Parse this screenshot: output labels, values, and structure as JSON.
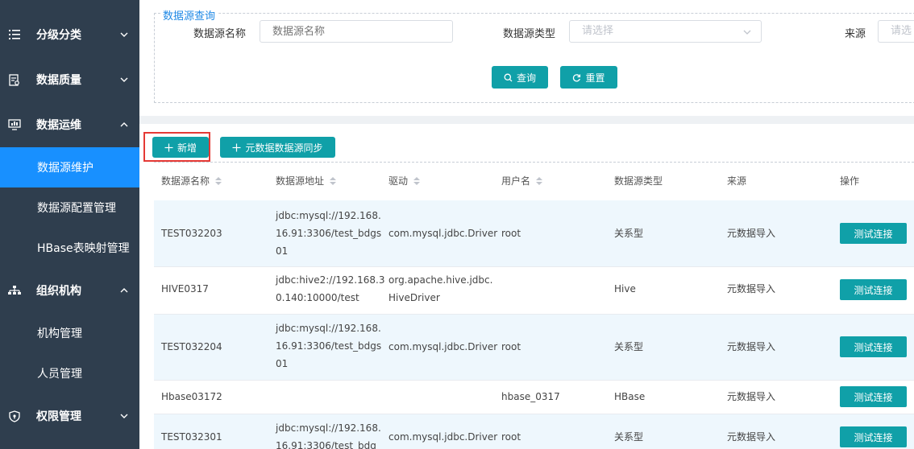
{
  "sidebar": {
    "items": [
      {
        "label": "分级分类",
        "icon": "list-icon",
        "expanded": false
      },
      {
        "label": "数据质量",
        "icon": "report-icon",
        "expanded": false
      },
      {
        "label": "数据运维",
        "icon": "monitor-icon",
        "expanded": true
      },
      {
        "label": "组织机构",
        "icon": "org-chart-icon",
        "expanded": true
      },
      {
        "label": "权限管理",
        "icon": "shield-icon",
        "expanded": false
      }
    ],
    "ops_children": [
      "数据源维护",
      "数据源配置管理",
      "HBase表映射管理"
    ],
    "org_children": [
      "机构管理",
      "人员管理"
    ],
    "active": "数据源维护",
    "colors": {
      "bg": "#2f3e4e",
      "active": "#1890ff"
    }
  },
  "query": {
    "legend": "数据源查询",
    "name_label": "数据源名称",
    "name_placeholder": "数据源名称",
    "type_label": "数据源类型",
    "type_placeholder": "请选择",
    "source_label": "来源",
    "source_placeholder": "请选",
    "search_label": "查询",
    "reset_label": "重置"
  },
  "toolbar": {
    "add_label": "新增",
    "sync_label": "元数据数据源同步"
  },
  "table": {
    "headers": [
      "数据源名称",
      "数据源地址",
      "驱动",
      "用户名",
      "数据源类型",
      "来源",
      "操作"
    ],
    "action_label": "测试连接",
    "rows": [
      {
        "name": "TEST032203",
        "address": [
          "jdbc:mysql://192.168.",
          "16.91:3306/test_bdgs",
          "01"
        ],
        "driver": [
          "com.mysql.jdbc.Driver"
        ],
        "user": "root",
        "type": "关系型",
        "source": "元数据导入"
      },
      {
        "name": "HIVE0317",
        "address": [
          "jdbc:hive2://192.168.3",
          "0.140:10000/test"
        ],
        "driver": [
          "org.apache.hive.jdbc.",
          "HiveDriver"
        ],
        "user": "",
        "type": "Hive",
        "source": "元数据导入"
      },
      {
        "name": "TEST032204",
        "address": [
          "jdbc:mysql://192.168.",
          "16.91:3306/test_bdgs",
          "01"
        ],
        "driver": [
          "com.mysql.jdbc.Driver"
        ],
        "user": "root",
        "type": "关系型",
        "source": "元数据导入"
      },
      {
        "name": "Hbase03172",
        "address": [],
        "driver": [],
        "user": "hbase_0317",
        "type": "HBase",
        "source": "元数据导入"
      },
      {
        "name": "TEST032301",
        "address": [
          "jdbc:mysql://192.168.",
          "16.91:3306/test_bdg"
        ],
        "driver": [
          "com.mysql.jdbc.Driver"
        ],
        "user": "root",
        "type": "关系型",
        "source": "元数据导入"
      }
    ]
  },
  "accent": "#10a0a8"
}
